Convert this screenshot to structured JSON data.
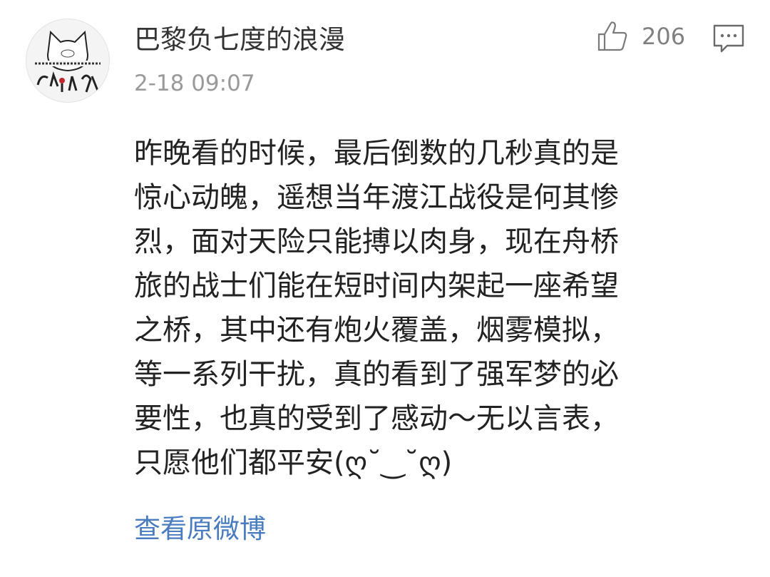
{
  "comment": {
    "author": "巴黎负七度的浪漫",
    "timestamp": "2-18 09:07",
    "likes": "206",
    "body_lines": [
      "昨晚看的时候，最后倒数的几秒真的是",
      "惊心动魄，遥想当年渡江战役是何其惨",
      "烈，面对天险只能搏以肉身，现在舟桥",
      "旅的战士们能在短时间内架起一座希望",
      "之桥，其中还有炮火覆盖，烟雾模拟，",
      "等一系列干扰，真的看到了强军梦的必",
      "要性，也真的受到了感动～无以言表，",
      "只愿他们都平安(ღ˘‿˘ღ)"
    ],
    "view_original_label": "查看原微博"
  },
  "icons": {
    "avatar": "cat-avatar-icon",
    "like": "thumbs-up-icon",
    "reply": "comment-bubble-icon"
  },
  "colors": {
    "text": "#222222",
    "meta": "#9a9a9a",
    "link": "#4a7dbf"
  }
}
